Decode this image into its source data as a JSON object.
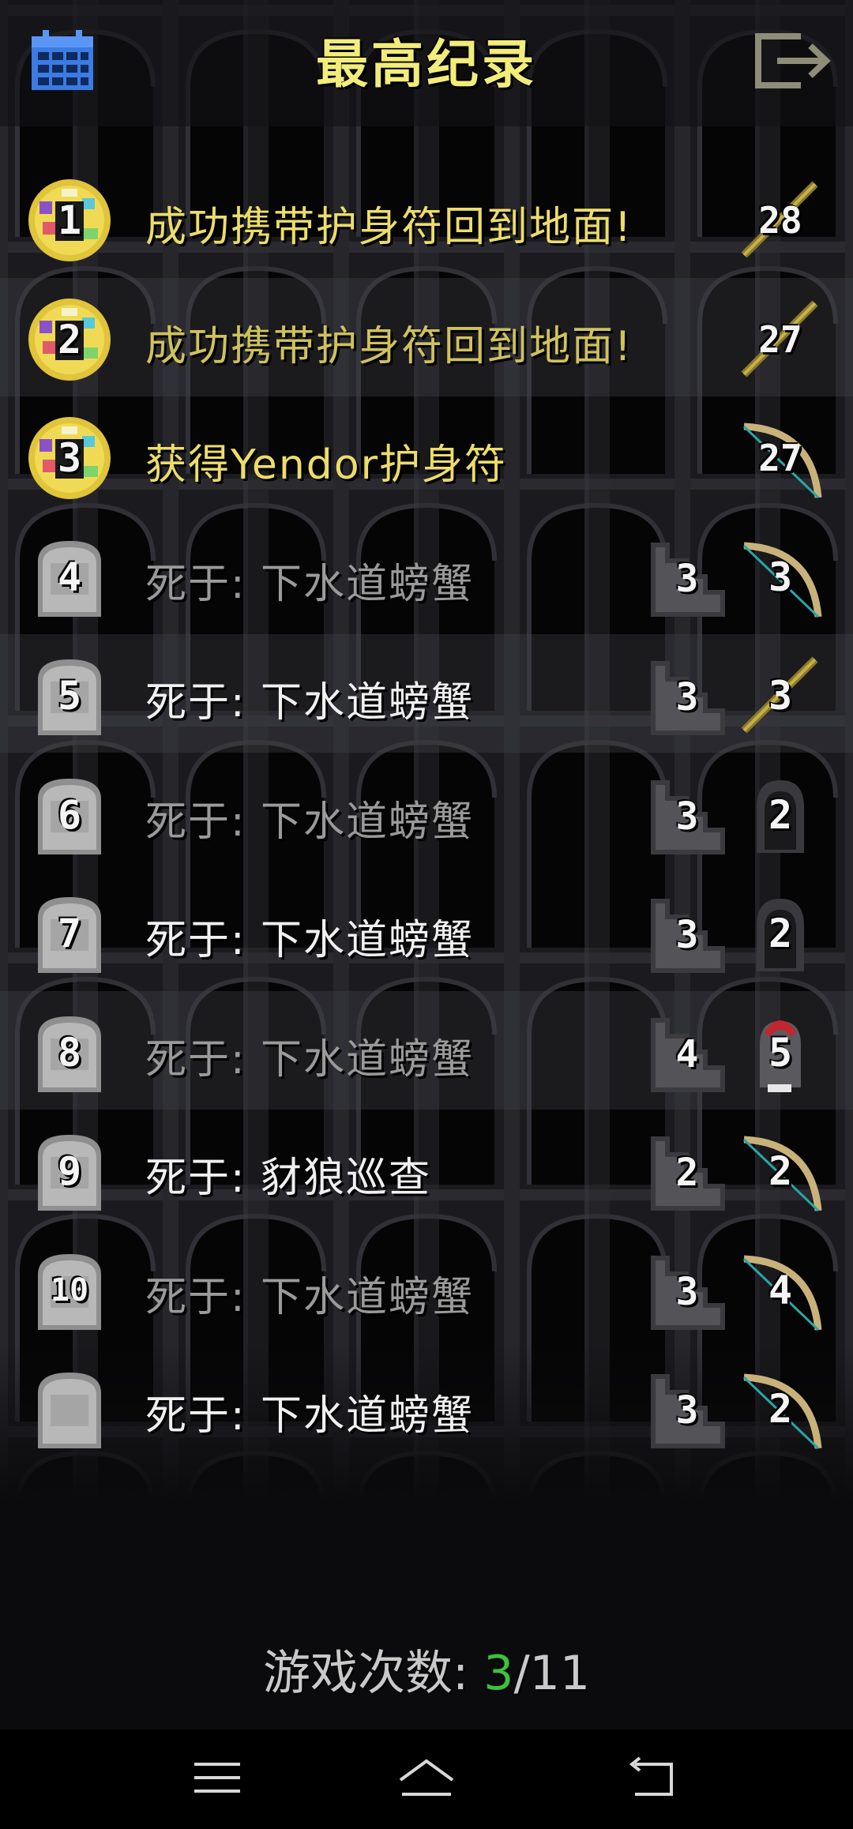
{
  "header": {
    "title": "最高纪录"
  },
  "records": [
    {
      "rank": "1",
      "badge": "amulet",
      "desc": "成功携带护身符回到地面!",
      "depth": null,
      "level": "28",
      "class_icon": "staff",
      "text_style": "gold",
      "highlight": false
    },
    {
      "rank": "2",
      "badge": "amulet",
      "desc": "成功携带护身符回到地面!",
      "depth": null,
      "level": "27",
      "class_icon": "staff",
      "text_style": "gold-dim",
      "highlight": true
    },
    {
      "rank": "3",
      "badge": "amulet",
      "desc": "获得Yendor护身符",
      "depth": null,
      "level": "27",
      "class_icon": "bow",
      "text_style": "gold",
      "highlight": false
    },
    {
      "rank": "4",
      "badge": "tombstone",
      "desc": "死于: 下水道螃蟹",
      "depth": "3",
      "level": "3",
      "class_icon": "bow",
      "text_style": "grey",
      "highlight": false
    },
    {
      "rank": "5",
      "badge": "tombstone",
      "desc": "死于: 下水道螃蟹",
      "depth": "3",
      "level": "3",
      "class_icon": "staff",
      "text_style": "white",
      "highlight": true
    },
    {
      "rank": "6",
      "badge": "tombstone",
      "desc": "死于: 下水道螃蟹",
      "depth": "3",
      "level": "2",
      "class_icon": "hood",
      "text_style": "grey",
      "highlight": false
    },
    {
      "rank": "7",
      "badge": "tombstone",
      "desc": "死于: 下水道螃蟹",
      "depth": "3",
      "level": "2",
      "class_icon": "hood",
      "text_style": "white",
      "highlight": false
    },
    {
      "rank": "8",
      "badge": "tombstone",
      "desc": "死于: 下水道螃蟹",
      "depth": "4",
      "level": "5",
      "class_icon": "helmet",
      "text_style": "grey",
      "highlight": true
    },
    {
      "rank": "9",
      "badge": "tombstone",
      "desc": "死于: 豺狼巡查",
      "depth": "2",
      "level": "2",
      "class_icon": "bow",
      "text_style": "white",
      "highlight": false
    },
    {
      "rank": "10",
      "badge": "tombstone",
      "desc": "死于: 下水道螃蟹",
      "depth": "3",
      "level": "4",
      "class_icon": "bow",
      "text_style": "grey",
      "highlight": false
    },
    {
      "rank": "",
      "badge": "tombstone",
      "desc": "死于: 下水道螃蟹",
      "depth": "3",
      "level": "2",
      "class_icon": "bow",
      "text_style": "white",
      "highlight": false
    }
  ],
  "games_played": {
    "label": "游戏次数:",
    "current": "3",
    "separator": "/",
    "total": "11"
  },
  "icons": {
    "calendar": "calendar-icon",
    "exit": "exit-icon",
    "nav": [
      "menu-icon",
      "home-icon",
      "back-icon"
    ]
  },
  "colors": {
    "title": "#f2ed7a",
    "gold_text": "#ecdd6a",
    "white_text": "#f0f0f0",
    "grey_text": "#9a9a9a",
    "games_current": "#3cc23c",
    "calendar_blue": "#3b7be3"
  }
}
